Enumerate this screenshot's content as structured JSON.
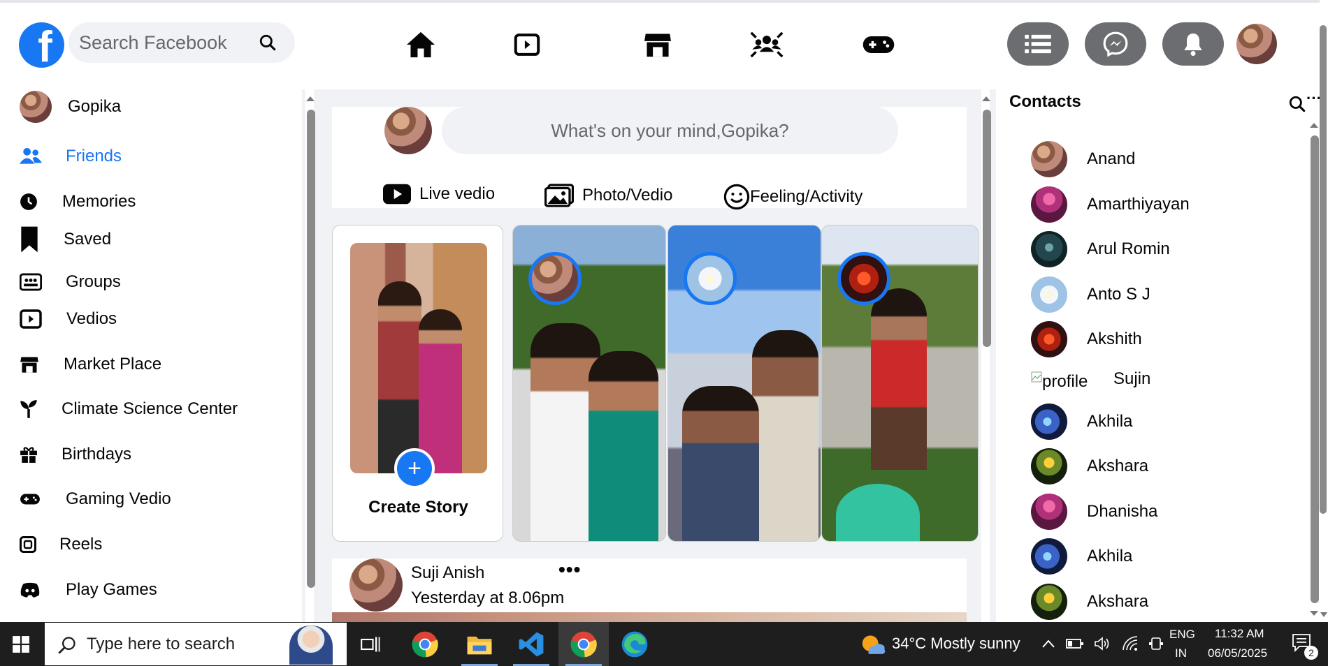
{
  "header": {
    "logo_letter": "f",
    "search_placeholder": "Search Facebook",
    "nav_icons": [
      "home-icon",
      "video-icon",
      "marketplace-icon",
      "groups-icon",
      "gaming-icon"
    ],
    "action_icons": [
      "menu-icon",
      "messenger-icon",
      "notifications-icon"
    ]
  },
  "sidebar": {
    "items": [
      {
        "label": "Gopika",
        "icon": "avatar"
      },
      {
        "label": "Friends",
        "icon": "friends-icon"
      },
      {
        "label": "Memories",
        "icon": "clock-icon"
      },
      {
        "label": "Saved",
        "icon": "bookmark-icon"
      },
      {
        "label": "Groups",
        "icon": "groups-icon"
      },
      {
        "label": "Vedios",
        "icon": "video-icon"
      },
      {
        "label": "Market Place",
        "icon": "store-icon"
      },
      {
        "label": "Climate Science Center",
        "icon": "sprout-icon"
      },
      {
        "label": "Birthdays",
        "icon": "gift-icon"
      },
      {
        "label": "Gaming Vedio",
        "icon": "gamepad-icon"
      },
      {
        "label": "Reels",
        "icon": "reels-icon"
      },
      {
        "label": "Play Games",
        "icon": "discord-icon"
      }
    ]
  },
  "composer": {
    "placeholder": "What's on your mind,Gopika?",
    "actions": [
      "Live vedio",
      "Photo/Vedio",
      "Feeling/Activity"
    ]
  },
  "stories": {
    "create_label": "Create Story",
    "plus": "+"
  },
  "post": {
    "author": "Suji Anish",
    "time": "Yesterday at 8.06pm",
    "more": "•••"
  },
  "contacts": {
    "title": "Contacts",
    "list": [
      {
        "name": "Anand"
      },
      {
        "name": "Amarthiyayan"
      },
      {
        "name": "Arul Romin"
      },
      {
        "name": "Anto S J"
      },
      {
        "name": "Akshith"
      },
      {
        "name": "Sujin",
        "broken_image_alt": "profile"
      },
      {
        "name": "Akhila"
      },
      {
        "name": "Akshara"
      },
      {
        "name": "Dhanisha"
      },
      {
        "name": "Akhila"
      },
      {
        "name": "Akshara"
      }
    ]
  },
  "taskbar": {
    "search_placeholder": "Type here to search",
    "weather": "34°C  Mostly sunny",
    "lang_top": "ENG",
    "lang_bottom": "IN",
    "time": "11:32 AM",
    "date": "06/05/2025",
    "notification_count": "2"
  },
  "colors": {
    "brand_blue": "#1877f2",
    "topbar_button_gray": "#6b6d70",
    "taskbar": "#1e1e1e"
  }
}
